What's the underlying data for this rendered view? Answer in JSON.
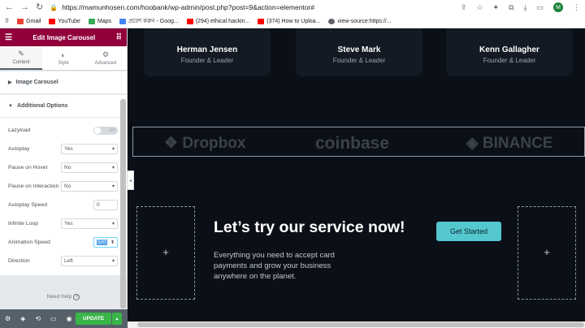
{
  "browser": {
    "url": "https://mamunhosen.com/hoobank/wp-admin/post.php?post=9&action=elementor#",
    "avatar_letter": "M",
    "bookmarks": [
      {
        "label": "Gmail",
        "color": "#ea4335"
      },
      {
        "label": "YouTube",
        "color": "#ff0000"
      },
      {
        "label": "Maps",
        "color": "#34a853"
      },
      {
        "label": "প্রবেশ করুন - Goog...",
        "color": "#4285f4"
      },
      {
        "label": "(294) ethical hackin...",
        "color": "#ff0000"
      },
      {
        "label": "(374) How to Uploa...",
        "color": "#ff0000"
      },
      {
        "label": "view-source:https://...",
        "color": "#5f6368"
      }
    ]
  },
  "panel": {
    "title": "Edit Image Carousel",
    "tabs": [
      "Content",
      "Style",
      "Advanced"
    ],
    "section_carousel": "Image Carousel",
    "section_additional": "Additional Options",
    "options": {
      "lazyload": {
        "label": "Lazyload",
        "toggle": "NO"
      },
      "autoplay": {
        "label": "Autoplay",
        "value": "Yes"
      },
      "pause_hover": {
        "label": "Pause on Hover",
        "value": "No"
      },
      "pause_interaction": {
        "label": "Pause on Interaction",
        "value": "No"
      },
      "autoplay_speed": {
        "label": "Autoplay Speed",
        "value": "0"
      },
      "infinite_loop": {
        "label": "Infinite Loop",
        "value": "Yes"
      },
      "animation_speed": {
        "label": "Animation Speed",
        "value": "500"
      },
      "direction": {
        "label": "Direction",
        "value": "Left"
      }
    },
    "need_help": "Need Help",
    "update": "UPDATE"
  },
  "canvas": {
    "testimonials": [
      {
        "name": "Herman Jensen",
        "role": "Founder & Leader"
      },
      {
        "name": "Steve Mark",
        "role": "Founder & Leader"
      },
      {
        "name": "Kenn Gallagher",
        "role": "Founder & Leader"
      }
    ],
    "logos": [
      "Dropbox",
      "coinbase",
      "BINANCE"
    ],
    "cta": {
      "title": "Let’s try our service now!",
      "button": "Get Started",
      "text": "Everything you need to accept card payments and grow your business anywhere on the planet."
    },
    "add_symbol": "+"
  }
}
